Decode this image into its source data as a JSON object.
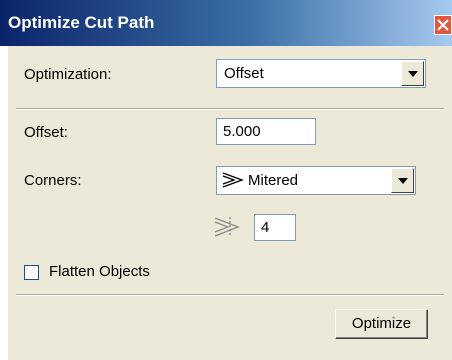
{
  "window": {
    "title": "Optimize Cut Path",
    "close_icon": "close-icon"
  },
  "optimization": {
    "label": "Optimization:",
    "value": "Offset"
  },
  "offset": {
    "label": "Offset:",
    "value": "5.000"
  },
  "corners": {
    "label": "Corners:",
    "value": "Mitered",
    "icon": "mitered-corner-icon"
  },
  "miter_limit": {
    "icon": "miter-limit-icon",
    "value": "4"
  },
  "flatten": {
    "label": "Flatten Objects",
    "checked": false
  },
  "actions": {
    "optimize_label": "Optimize"
  },
  "colors": {
    "titlebar_start": "#0a246a",
    "titlebar_end": "#a6caf0",
    "panel": "#ece9d8",
    "close_button": "#e2563b"
  }
}
